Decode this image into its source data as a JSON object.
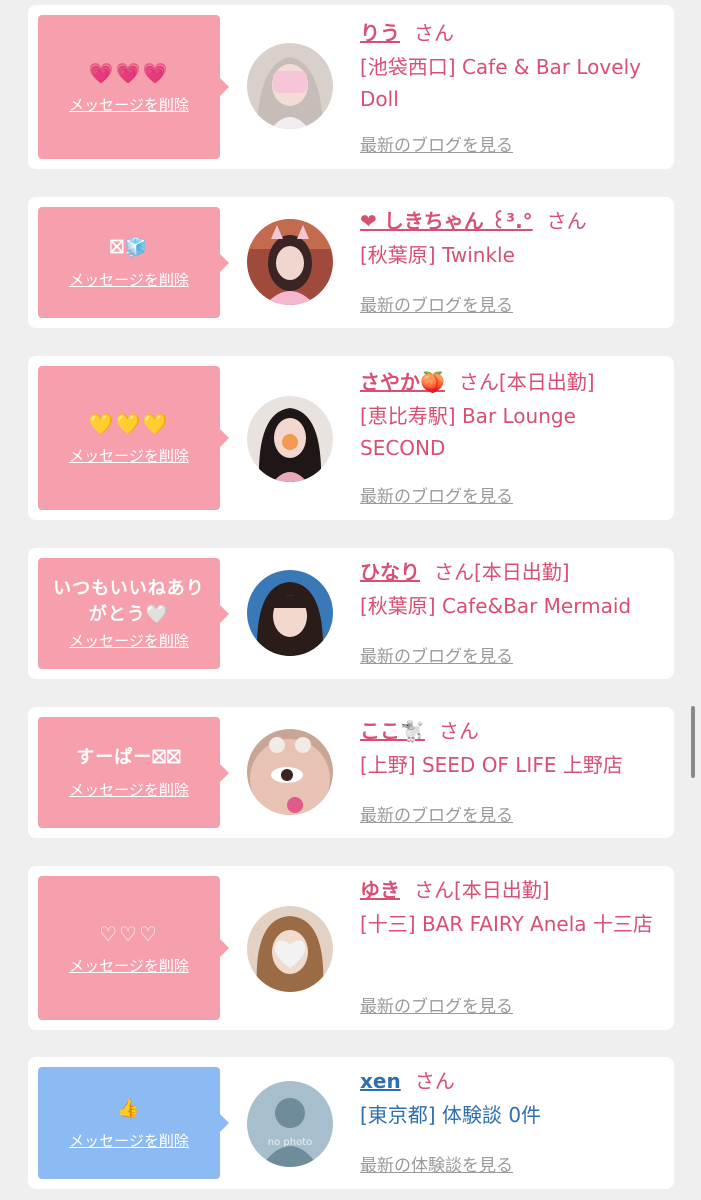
{
  "delete_label": "メッセージを削除",
  "san_label": "さん",
  "cards": [
    {
      "message": "💗💗💗",
      "name": "りう",
      "status": "",
      "shop": "[池袋西口] Cafe & Bar Lovely Doll",
      "link": "最新のブログを見る"
    },
    {
      "message": "⛝🧊",
      "name": "❤ しきちゃん ꒰³.°",
      "status": "",
      "shop": "[秋葉原] Twinkle",
      "link": "最新のブログを見る"
    },
    {
      "message": "💛💛💛",
      "name": "さやか🍑",
      "status": "[本日出勤]",
      "shop": "[恵比寿駅] Bar Lounge SECOND",
      "link": "最新のブログを見る"
    },
    {
      "message": "いつもいいねありがとう🤍",
      "name": "ひなり",
      "status": "[本日出勤]",
      "shop": "[秋葉原] Cafe&Bar Mermaid",
      "link": "最新のブログを見る"
    },
    {
      "message": "すーぱー⛝⛝",
      "name": "ここ🐩",
      "status": "",
      "shop": "[上野] SEED OF LIFE 上野店",
      "link": "最新のブログを見る"
    },
    {
      "message": "♡♡♡",
      "name": "ゆき",
      "status": "[本日出勤]",
      "shop": "[十三] BAR FAIRY Anela 十三店",
      "link": "最新のブログを見る"
    },
    {
      "message": "👍",
      "name": "xen",
      "status": "",
      "shop": "[東京都] 体験談 0件",
      "link": "最新の体験談を見る",
      "avatar_text": "no photo"
    }
  ],
  "colors": {
    "pink": "#f5a0ac",
    "blue": "#8cbaf2",
    "name_pink": "#d94f73",
    "name_blue": "#2f6fb0",
    "link_gray": "#9a9a9a"
  }
}
